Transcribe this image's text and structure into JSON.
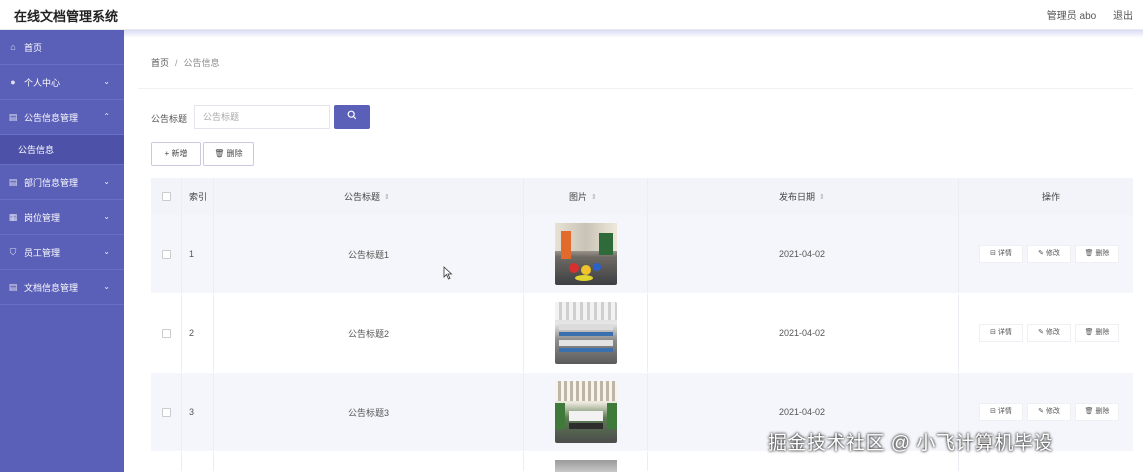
{
  "header": {
    "title": "在线文档管理系统",
    "user": "管理员 abo",
    "logout": "退出"
  },
  "sidebar": {
    "items": [
      {
        "label": "首页",
        "icon": "home-icon",
        "expandable": false
      },
      {
        "label": "个人中心",
        "icon": "user-icon",
        "expandable": true
      },
      {
        "label": "公告信息管理",
        "icon": "list-icon",
        "expandable": true,
        "expanded": true
      },
      {
        "label": "部门信息管理",
        "icon": "list-icon",
        "expandable": true
      },
      {
        "label": "岗位管理",
        "icon": "grid-icon",
        "expandable": true
      },
      {
        "label": "员工管理",
        "icon": "shield-icon",
        "expandable": true
      },
      {
        "label": "文档信息管理",
        "icon": "list-icon",
        "expandable": true
      }
    ],
    "sub_item": "公告信息"
  },
  "breadcrumb": {
    "home": "首页",
    "sep": "/",
    "current": "公告信息"
  },
  "search": {
    "label": "公告标题",
    "placeholder": "公告标题",
    "icon": "search-icon"
  },
  "toolbar": {
    "add_label": "+ 新增",
    "delete_label": "🗑 删除"
  },
  "table": {
    "headers": {
      "index": "索引",
      "title": "公告标题",
      "image": "图片",
      "date": "发布日期",
      "action": "操作"
    },
    "rows": [
      {
        "index": "1",
        "title": "公告标题1",
        "date": "2021-04-02"
      },
      {
        "index": "2",
        "title": "公告标题2",
        "date": "2021-04-02"
      },
      {
        "index": "3",
        "title": "公告标题3",
        "date": "2021-04-02"
      }
    ],
    "actions": {
      "detail": "详情",
      "edit": "修改",
      "delete": "删除"
    }
  },
  "watermark": "掘金技术社区 @ 小飞计算机毕设",
  "colors": {
    "accent": "#5a5fb8",
    "sidebar": "#5a5fb8",
    "header_bg": "#f3f4fa"
  }
}
